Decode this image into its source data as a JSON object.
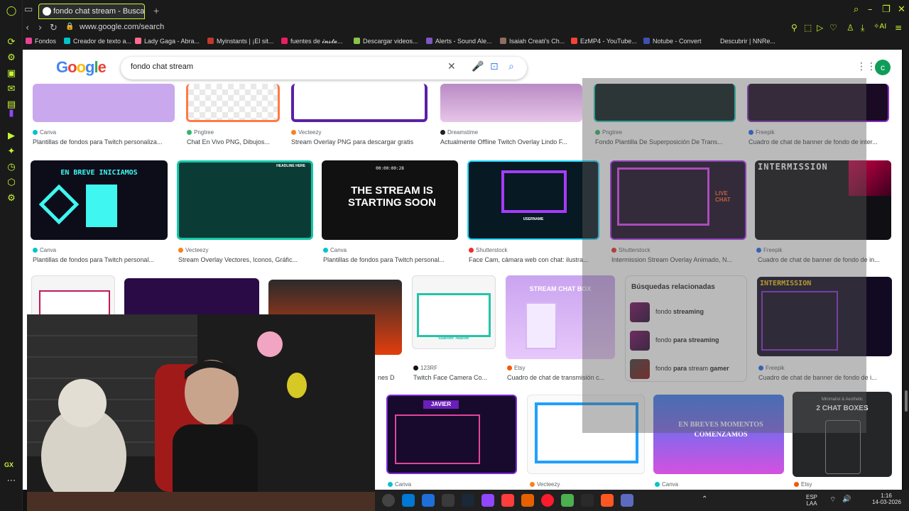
{
  "tab": {
    "title": "fondo chat stream - Busca"
  },
  "address": {
    "url": "www.google.com/search"
  },
  "toolbar": {
    "ai_label": "AI"
  },
  "bookmarks": [
    "Fondos",
    "Creador de texto a...",
    "Lady Gaga - Abra...",
    "Myinstants | ¡El sit...",
    "fuentes de 𝓲𝓷𝓼𝓽𝓪...",
    "Descargar videos...",
    "Alerts - Sound Ale...",
    "Isaiah Creati's Ch...",
    "EzMP4 - YouTube...",
    "Notube - Convert",
    "Descubrir | NNRe..."
  ],
  "search": {
    "logo": "Google",
    "query": "fondo chat stream",
    "avatar": "c"
  },
  "results_row1": [
    {
      "source": "Canva",
      "title": "Plantillas de fondos para Twitch personaliza..."
    },
    {
      "source": "Pngtree",
      "title": "Chat En Vivo PNG, Dibujos..."
    },
    {
      "source": "Vecteezy",
      "title": "Stream Overlay PNG para descargar gratis"
    },
    {
      "source": "Dreamstime",
      "title": "Actualmente Offline Twitch Overlay Lindo F..."
    },
    {
      "source": "Pngtree",
      "title": "Fondo Plantilla De Superposición De Trans..."
    },
    {
      "source": "Freepik",
      "title": "Cuadro de chat de banner de fondo de inter..."
    }
  ],
  "results_row2": [
    {
      "source": "Canva",
      "title": "Plantillas de fondos para Twitch personal...",
      "thumb_text": "EN BREVE INICIAMOS"
    },
    {
      "source": "Vecteezy",
      "title": "Stream Overlay Vectores, Iconos, Gráfic...",
      "thumb_text": "HEADLINE HERE"
    },
    {
      "source": "Canva",
      "title": "Plantillas de fondos para Twitch personal...",
      "thumb_text": "THE STREAM IS STARTING SOON",
      "thumb_time": "00:00:00:28"
    },
    {
      "source": "Shutterstock",
      "title": "Face Cam, cámara web con chat: ilustra...",
      "thumb_text": "USERNAME"
    },
    {
      "source": "Shutterstock",
      "title": "Intermission Stream Overlay Animado, N...",
      "thumb_text": "LIVE CHAT"
    },
    {
      "source": "Freepik",
      "title": "Cuadro de chat de banner de fondo de in...",
      "thumb_text": "INTERMISSION"
    }
  ],
  "results_row3": [
    {
      "source": "123RF",
      "title": "Twitch Face Camera Co...",
      "thumb_text": "Gamer Name"
    },
    {
      "source": "Etsy",
      "title": "Cuadro de chat de transmisión c...",
      "thumb_text": "STREAM CHAT BOX"
    },
    {
      "source": "Freepik",
      "title": "Cuadro de chat de banner de fondo de i...",
      "thumb_text": "INTERMISSION"
    }
  ],
  "partial_title": "nes D",
  "related": {
    "title": "Búsquedas relacionadas",
    "items": [
      {
        "prefix": "fondo ",
        "bold": "streaming",
        "suffix": ""
      },
      {
        "prefix": "fondo ",
        "bold": "para streaming",
        "suffix": ""
      },
      {
        "prefix": "fondo ",
        "bold": "para",
        "suffix": " stream ",
        "bold2": "gamer"
      }
    ]
  },
  "results_row4": [
    {
      "source": "Canva",
      "thumb_text": "JAVIER"
    },
    {
      "source": "Vecteezy",
      "thumb_text": ""
    },
    {
      "source": "Canva",
      "thumb_text": "EN BREVES MOMENTOS COMENZAMOS"
    },
    {
      "source": "Etsy",
      "thumb_text": "2 CHAT BOXES",
      "thumb_sub": "Minimalist & Aesthetic"
    }
  ],
  "taskbar": {
    "lang": "ESP",
    "lang2": "LAA",
    "time": "1:16",
    "date": "14-03-2026"
  },
  "colors": {
    "accent": "#c6f432",
    "page_bg": "#ffffff",
    "browser_bg": "#1a1a1a"
  }
}
